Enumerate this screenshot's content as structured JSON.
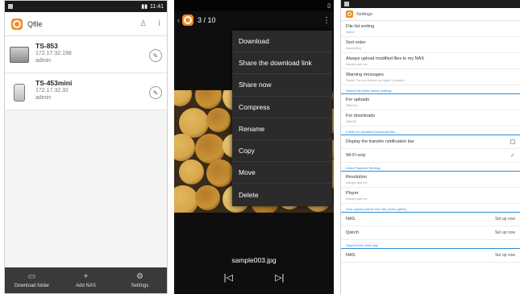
{
  "phone1": {
    "status": {
      "time": "11:41"
    },
    "app_title": "Qfile",
    "devices": [
      {
        "name": "TS-853",
        "ip": "172.17.32.198",
        "user": "admin",
        "type": "rack"
      },
      {
        "name": "TS-453mini",
        "ip": "172.17.32.32",
        "user": "admin",
        "type": "tower"
      }
    ],
    "bottom_nav": [
      {
        "label": "Download folder",
        "icon": "download-folder-icon",
        "glyph": "▭"
      },
      {
        "label": "Add NAS",
        "icon": "add-icon",
        "glyph": "+"
      },
      {
        "label": "Settings",
        "icon": "gear-icon",
        "glyph": "⚙"
      }
    ],
    "colors": {
      "brand": "#f08a24",
      "bottom_bar": "#3a3a3a"
    }
  },
  "phone2": {
    "counter": "3 / 10",
    "menu": [
      "Download",
      "Share the download link",
      "Share now",
      "Compress",
      "Rename",
      "Copy",
      "Move",
      "Delete"
    ],
    "filename": "sample003.jpg"
  },
  "phone3": {
    "title": "Settings",
    "rows": [
      {
        "kind": "item",
        "title": "File list sorting",
        "sub": "Name",
        "right": ""
      },
      {
        "kind": "item",
        "title": "Sort order",
        "sub": "Ascending",
        "right": ""
      },
      {
        "kind": "item",
        "title": "Always upload modified files to my NAS",
        "sub": "Always ask me",
        "right": ""
      },
      {
        "kind": "item",
        "title": "Warning messages",
        "sub": "Reset \"Do not remind me again\" prompts",
        "right": ""
      },
      {
        "kind": "section",
        "title": "Default file folder status settings"
      },
      {
        "kind": "item",
        "title": "For uploads",
        "sub": "Qfile/Up",
        "right": ""
      },
      {
        "kind": "item",
        "title": "For downloads",
        "sub": "Qfile/Dl",
        "right": ""
      },
      {
        "kind": "section",
        "title": "Folder for uploaded download files"
      },
      {
        "kind": "item",
        "title": "Display the transfer notification bar",
        "sub": "",
        "right": "box"
      },
      {
        "kind": "item",
        "title": "Wi-Fi only",
        "sub": "",
        "right": "check"
      },
      {
        "kind": "section",
        "title": "Video Playback Settings"
      },
      {
        "kind": "item",
        "title": "Resolution",
        "sub": "Always ask me",
        "right": ""
      },
      {
        "kind": "item",
        "title": "Player",
        "sub": "Always ask me",
        "right": ""
      },
      {
        "kind": "section",
        "title": "Auto upload photos from the phone gallery"
      },
      {
        "kind": "item",
        "title": "NAS",
        "sub": "",
        "right": "Set up now"
      },
      {
        "kind": "item",
        "title": "Qsirch",
        "sub": "",
        "right": "Set up now"
      },
      {
        "kind": "section",
        "title": "Shared from other app"
      },
      {
        "kind": "item",
        "title": "NAS",
        "sub": "",
        "right": "Set up now"
      }
    ],
    "colors": {
      "section": "#2a8cd6",
      "check": "#1e88e5"
    }
  }
}
